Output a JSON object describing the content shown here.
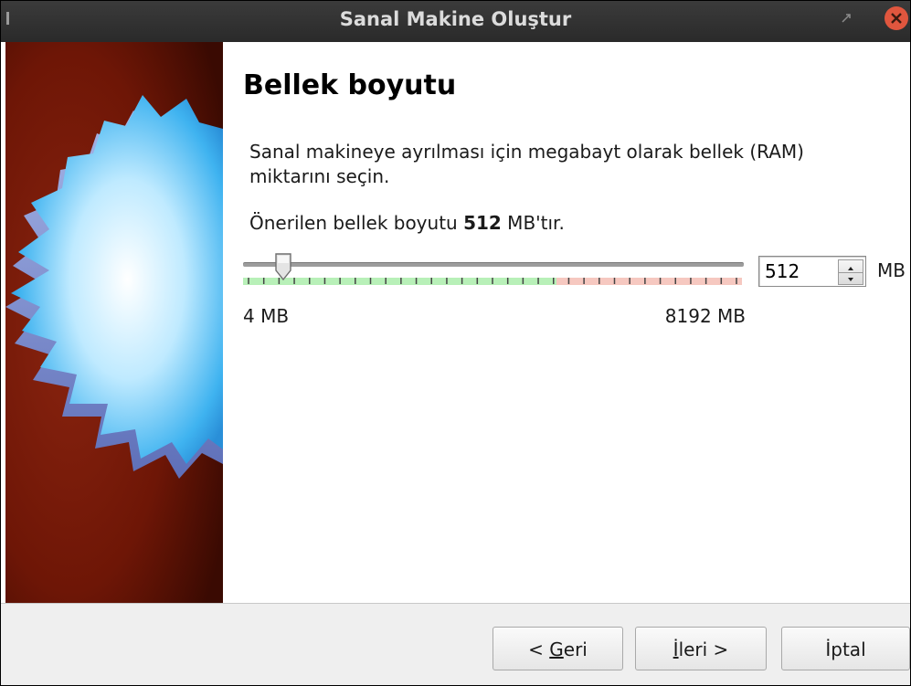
{
  "window": {
    "title": "Sanal Makine Oluştur"
  },
  "page": {
    "title": "Bellek boyutu",
    "description": "Sanal makineye ayrılması için megabayt olarak bellek (RAM) miktarını seçin.",
    "recommended_prefix": "Önerilen bellek boyutu ",
    "recommended_value": "512",
    "recommended_suffix": " MB'tır."
  },
  "memory": {
    "value": "512",
    "unit": "MB",
    "min_label": "4 MB",
    "max_label": "8192 MB",
    "min_mb": 4,
    "max_mb": 8192,
    "slider_value_mb": 512
  },
  "buttons": {
    "back_prefix": "< ",
    "back_mnemonic": "G",
    "back_rest": "eri",
    "next_mnemonic": "İ",
    "next_rest": "leri >",
    "cancel": "İptal"
  },
  "colors": {
    "tick_safe": "#b8f0b8",
    "tick_warn": "#f6c8c0",
    "close_button": "#e0563e",
    "art_background": "#7a1a0a"
  },
  "icons": [
    "restore-icon",
    "close-icon",
    "spin-up-icon",
    "spin-down-icon",
    "virtualbox-star-art"
  ]
}
